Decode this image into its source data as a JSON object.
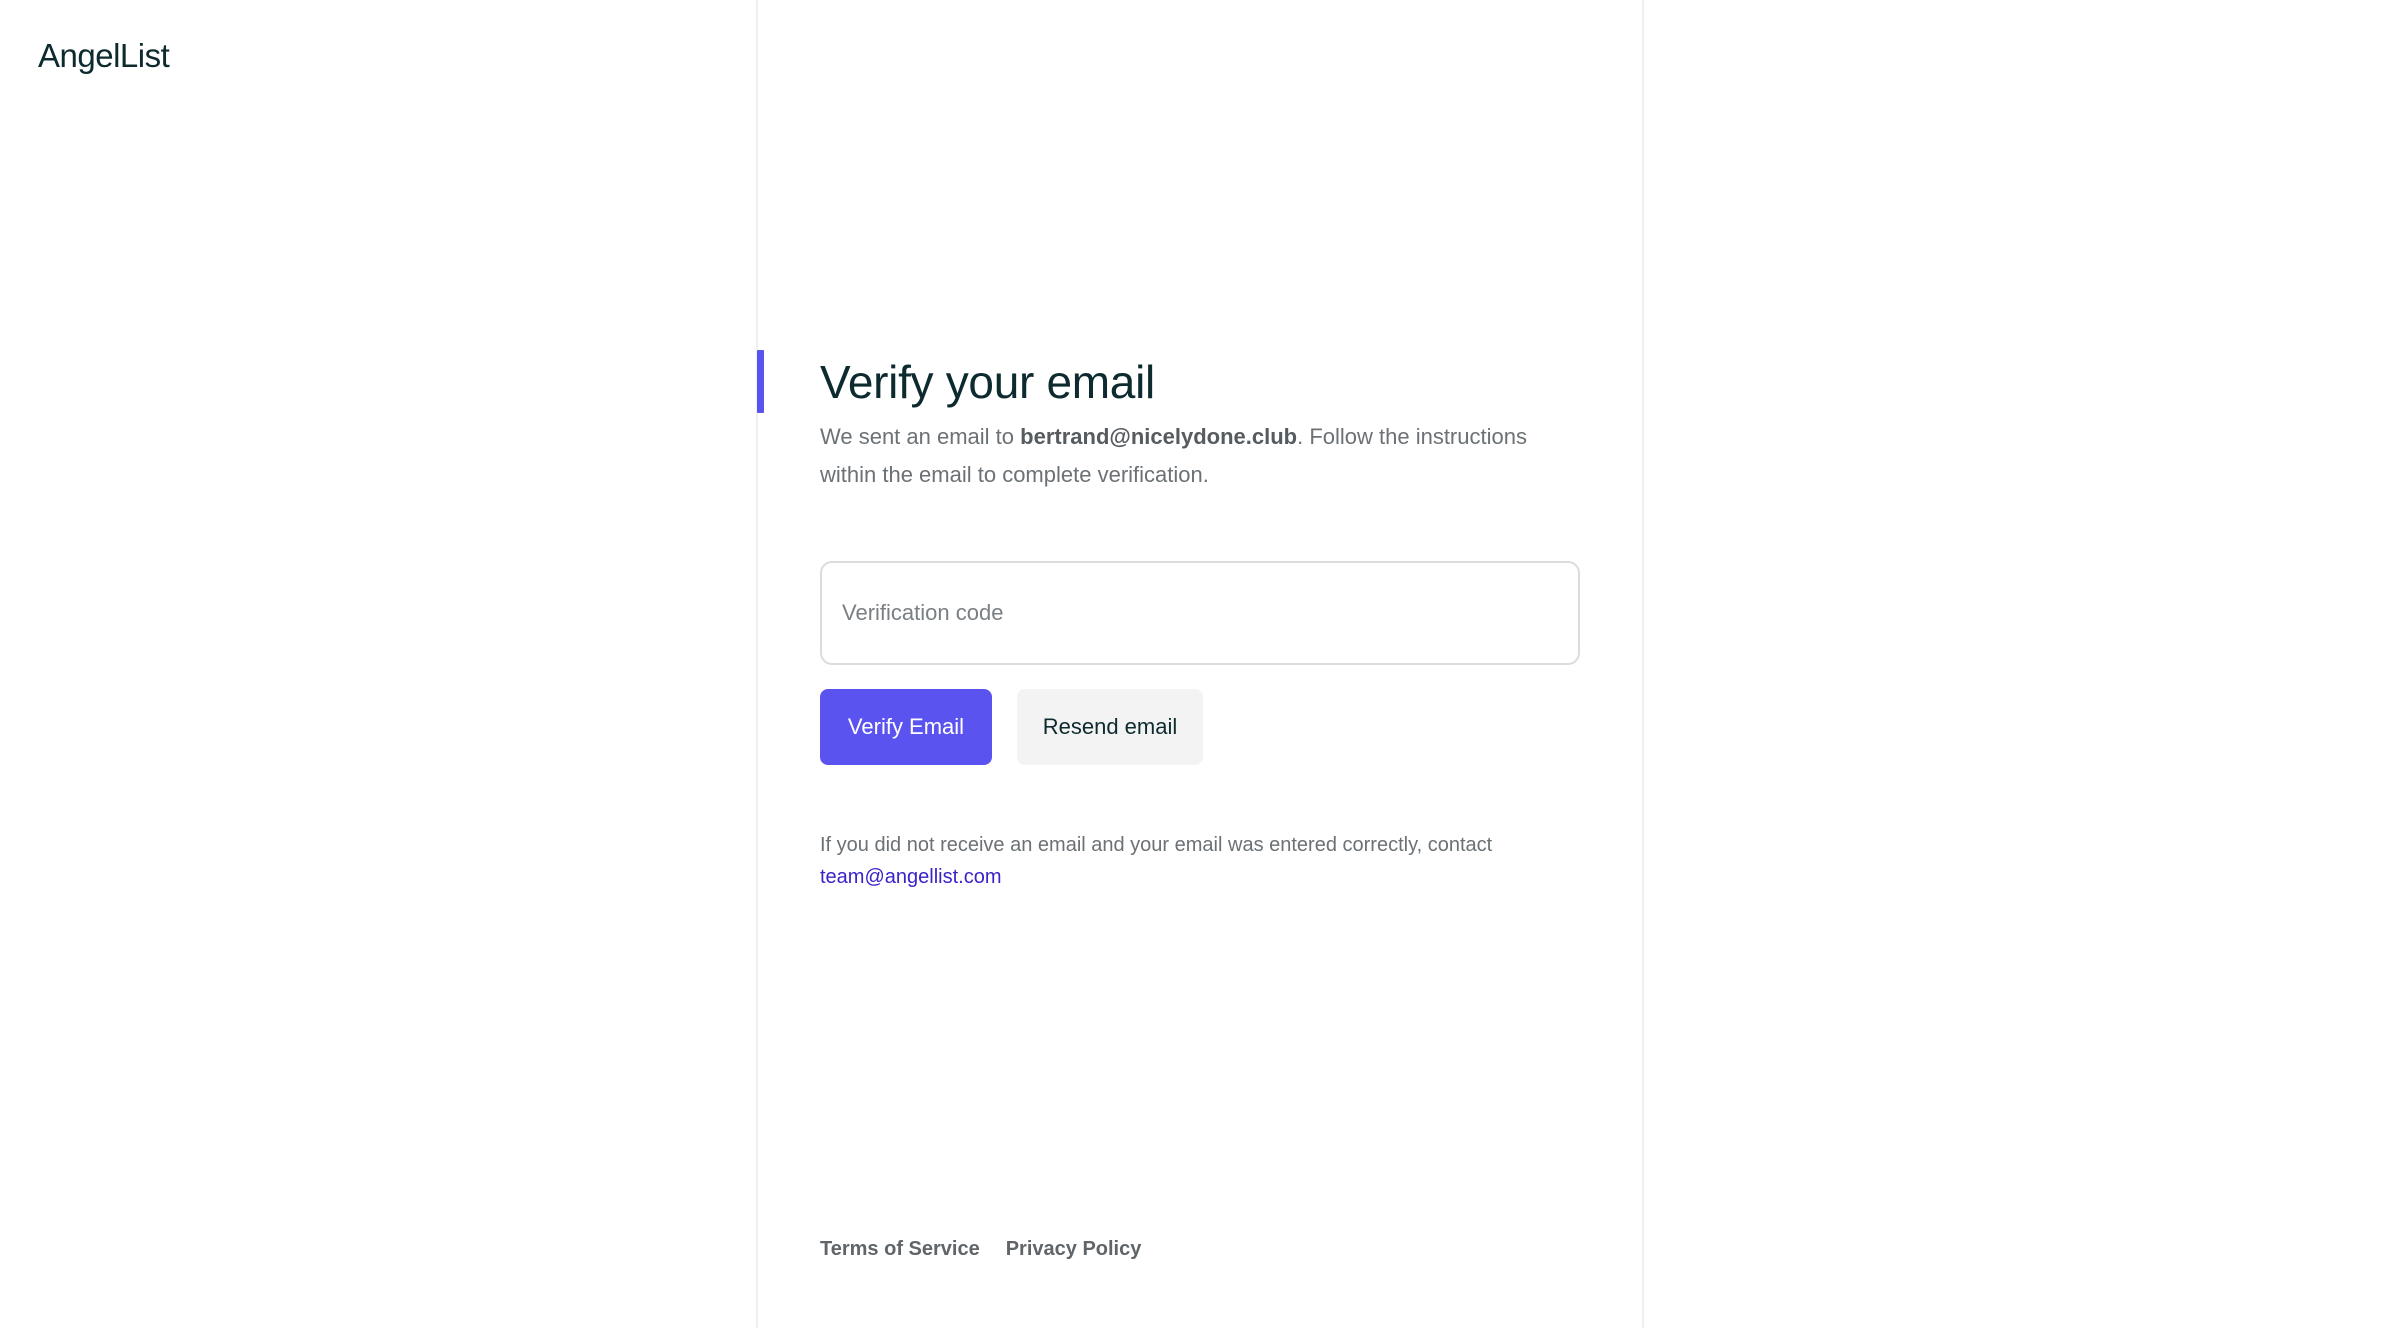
{
  "brand": {
    "logo_text": "AngelList"
  },
  "verify": {
    "title": "Verify your email",
    "desc_prefix": "We sent an email to ",
    "email": "bertrand@nicelydone.club",
    "desc_suffix": ". Follow the instructions within the email to complete verification.",
    "code_placeholder": "Verification code",
    "code_value": "",
    "verify_button": "Verify Email",
    "resend_button": "Resend email",
    "help_text": "If you did not receive an email and your email was entered correctly, contact",
    "support_email": "team@angellist.com"
  },
  "footer": {
    "terms": "Terms of Service",
    "privacy": "Privacy Policy"
  },
  "colors": {
    "accent": "#5b53f0",
    "link": "#3a23c8",
    "text_dark": "#0d2a2e",
    "text_muted": "#6b7175"
  }
}
